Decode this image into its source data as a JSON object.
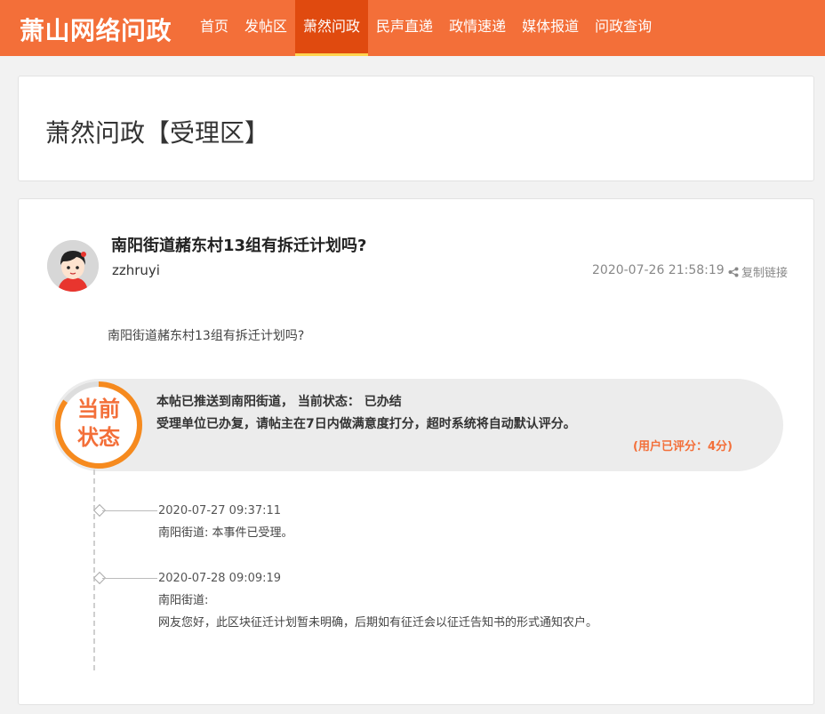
{
  "header": {
    "logo": "萧山网络问政",
    "nav": [
      {
        "label": "首页",
        "active": false
      },
      {
        "label": "发帖区",
        "active": false
      },
      {
        "label": "萧然问政",
        "active": true
      },
      {
        "label": "民声直递",
        "active": false
      },
      {
        "label": "政情速递",
        "active": false
      },
      {
        "label": "媒体报道",
        "active": false
      },
      {
        "label": "问政查询",
        "active": false
      }
    ]
  },
  "section": {
    "title": "萧然问政【受理区】"
  },
  "post": {
    "title": "南阳街道赭东村13组有拆迁计划吗?",
    "author": "zzhruyi",
    "time": "2020-07-26 21:58:19",
    "copy_link_label": "复制链接",
    "body": "南阳街道赭东村13组有拆迁计划吗?"
  },
  "status": {
    "badge": "当前状态",
    "line1": "本帖已推送到南阳街道， 当前状态： 已办结",
    "line2": "受理单位已办复，请帖主在7日内做满意度打分，超时系统将自动默认评分。",
    "rating": "(用户已评分：4分)"
  },
  "timeline": [
    {
      "time": "2020-07-27 09:37:11",
      "lines": [
        "南阳街道: 本事件已受理。"
      ]
    },
    {
      "time": "2020-07-28 09:09:19",
      "lines": [
        "南阳街道:",
        "网友您好，此区块征迁计划暂未明确，后期如有征迁会以征迁告知书的形式通知农户。"
      ]
    }
  ],
  "colors": {
    "brand": "#f36f39",
    "nav_active": "#e04a0f",
    "nav_underline": "#ffd44f"
  }
}
